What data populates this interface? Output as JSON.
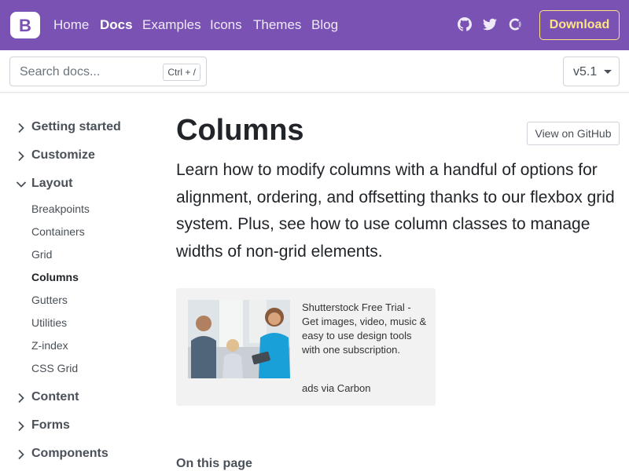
{
  "navbar": {
    "links": [
      "Home",
      "Docs",
      "Examples",
      "Icons",
      "Themes",
      "Blog"
    ],
    "active": "Docs",
    "icons": [
      "github-icon",
      "twitter-icon",
      "opencollective-icon"
    ],
    "download_label": "Download",
    "brand_letter": "B"
  },
  "subnav": {
    "search_placeholder": "Search docs...",
    "shortcut": "Ctrl + /",
    "version": "v5.1"
  },
  "sidebar": {
    "sections": [
      {
        "label": "Getting started",
        "expanded": false
      },
      {
        "label": "Customize",
        "expanded": false
      },
      {
        "label": "Layout",
        "expanded": true,
        "items": [
          "Breakpoints",
          "Containers",
          "Grid",
          "Columns",
          "Gutters",
          "Utilities",
          "Z-index",
          "CSS Grid"
        ]
      },
      {
        "label": "Content",
        "expanded": false
      },
      {
        "label": "Forms",
        "expanded": false
      },
      {
        "label": "Components",
        "expanded": false
      }
    ],
    "active_item": "Columns"
  },
  "main": {
    "title": "Columns",
    "github_button": "View on GitHub",
    "lead": "Learn how to modify columns with a handful of options for alignment, ordering, and offsetting thanks to our flexbox grid system. Plus, see how to use column classes to manage widths of non-grid elements.",
    "ad": {
      "text": "Shutterstock Free Trial - Get images, video, music & easy to use design tools with one subscription.",
      "via": "ads via Carbon"
    },
    "toc_heading": "On this page"
  },
  "colors": {
    "brand": "#7952b3",
    "download": "#ffe484"
  }
}
